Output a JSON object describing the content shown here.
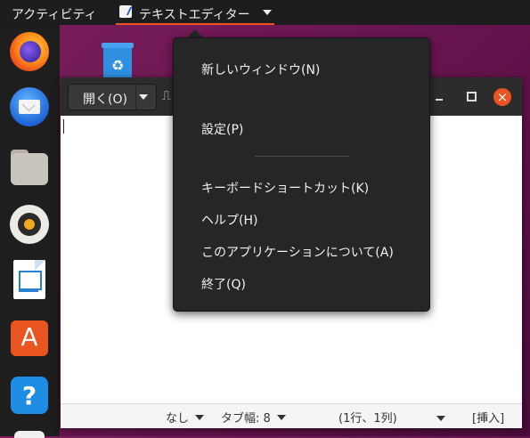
{
  "topbar": {
    "activities_label": "アクティビティ",
    "app_menu_label": "テキストエディター"
  },
  "dock": {
    "items": [
      {
        "name": "Firefox",
        "icon": "firefox-icon"
      },
      {
        "name": "Thunderbird",
        "icon": "thunderbird-icon"
      },
      {
        "name": "Files",
        "icon": "files-icon"
      },
      {
        "name": "Rhythmbox",
        "icon": "rhythmbox-icon"
      },
      {
        "name": "LibreOffice Writer",
        "icon": "writer-icon"
      },
      {
        "name": "Ubuntu Software",
        "icon": "software-icon"
      },
      {
        "name": "Help",
        "icon": "help-icon"
      }
    ]
  },
  "gedit": {
    "open_label": "開く(O)",
    "new_tab_symbol": "⎍",
    "close_symbol": "×",
    "status": {
      "language": "なし",
      "tab_width": "タブ幅: 8",
      "position": "(1行、1列)",
      "insert_mode": "[挿入]"
    }
  },
  "popup_menu": {
    "new_window": "新しいウィンドウ(N)",
    "preferences": "設定(P)",
    "shortcuts": "キーボードショートカット(K)",
    "help": "ヘルプ(H)",
    "about": "このアプリケーションについて(A)",
    "quit": "終了(Q)"
  },
  "colors": {
    "accent": "#e95420",
    "topbar": "#1d1d1d",
    "menu_bg": "#262626"
  }
}
